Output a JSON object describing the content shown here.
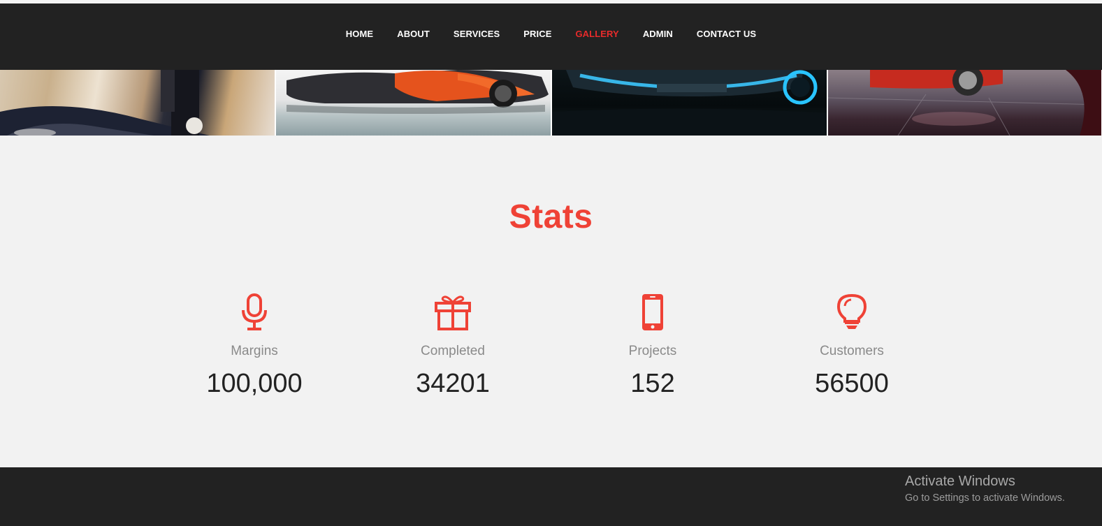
{
  "nav": {
    "items": [
      {
        "label": "HOME"
      },
      {
        "label": "ABOUT"
      },
      {
        "label": "SERVICES"
      },
      {
        "label": "PRICE"
      },
      {
        "label": "GALLERY",
        "active": true
      },
      {
        "label": "ADMIN"
      },
      {
        "label": "CONTACT US"
      }
    ]
  },
  "stats": {
    "title": "Stats",
    "items": [
      {
        "icon": "microphone-icon",
        "label": "Margins",
        "value": "100,000"
      },
      {
        "icon": "gift-icon",
        "label": "Completed",
        "value": "34201"
      },
      {
        "icon": "mobile-phone-icon",
        "label": "Projects",
        "value": "152"
      },
      {
        "icon": "lightbulb-icon",
        "label": "Customers",
        "value": "56500"
      }
    ]
  },
  "watermark": {
    "title": "Activate Windows",
    "subtitle": "Go to Settings to activate Windows."
  },
  "colors": {
    "accent": "#ef4236",
    "nav_bg": "#222222",
    "page_bg": "#f2f2f2"
  }
}
